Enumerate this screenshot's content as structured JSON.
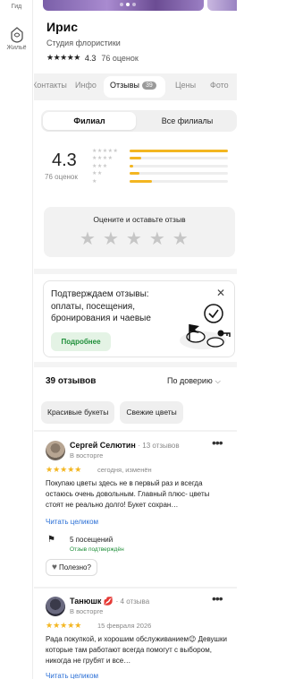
{
  "rail": {
    "guide_label": "Гид",
    "housing_label": "Жильё"
  },
  "place": {
    "title": "Ирис",
    "category": "Студия флористики",
    "stars": "★★★★★",
    "rating": "4.3",
    "reviews_count": "76 оценок"
  },
  "tabs": [
    {
      "label": "Контакты"
    },
    {
      "label": "Инфо"
    },
    {
      "label": "Отзывы",
      "badge": "39"
    },
    {
      "label": "Цены"
    },
    {
      "label": "Фото"
    }
  ],
  "toggle": {
    "branch": "Филиал",
    "all": "Все филиалы"
  },
  "summary": {
    "rating": "4.3",
    "count": "76 оценок",
    "distribution": [
      {
        "stars": "★★★★★",
        "fraction": 1.0
      },
      {
        "stars": "★★★★",
        "fraction": 0.12
      },
      {
        "stars": "★★★",
        "fraction": 0.04
      },
      {
        "stars": "★★",
        "fraction": 0.1
      },
      {
        "stars": "★",
        "fraction": 0.23
      }
    ]
  },
  "rate_box": {
    "title": "Оцените и оставьте отзыв",
    "stars": "★"
  },
  "promo": {
    "text": "Подтверждаем отзывы: оплаты, посещения, бронирования и чаевые",
    "button": "Подробнее",
    "close": "✕"
  },
  "list": {
    "header": "39 отзывов",
    "sort": "По доверию",
    "chips": [
      "Красивые букеты",
      "Свежие цветы"
    ]
  },
  "reviews": [
    {
      "name": "Сергей Селютин",
      "meta": "· 13 отзывов",
      "level": "В восторге",
      "stars": "★★★★★",
      "date": "сегодня, изменён",
      "text": "Покупаю цветы здесь не в первый раз и всегда остаюсь очень довольным. Главный плюс- цветы стоят не реально долго! Букет сохран…",
      "read_more": "Читать целиком",
      "visits": "5 посещений",
      "verified": "Отзыв подтверждён",
      "useful": "Полезно?"
    },
    {
      "name": "Танюшк 💋",
      "meta": "· 4 отзыва",
      "level": "В восторге",
      "stars": "★★★★★",
      "date": "15 февраля 2026",
      "text": "Рада покупкой, и хорошим обслуживанием😉 Девушки которые там работают всегда помогут с выбором, никогда не грубят и все…",
      "read_more": "Читать целиком"
    }
  ],
  "colors": {
    "accent_star": "#f3b621",
    "link": "#2a6fd6",
    "green": "#1f8f3a",
    "verified_bg": "#e4f3e5"
  },
  "icons": {
    "menu": "more-dots-icon",
    "close": "close-icon",
    "chevron": "chevron-down-icon",
    "heart": "heart-icon",
    "flag": "flag-icon"
  }
}
